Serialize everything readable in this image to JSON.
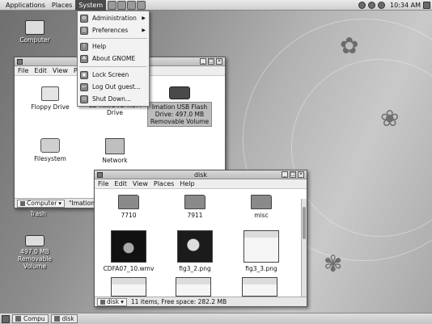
{
  "top_panel": {
    "menus": [
      "Applications",
      "Places",
      "System"
    ],
    "clock": "10:34 AM"
  },
  "system_menu": {
    "items": [
      {
        "label": "Administration",
        "icon": "admin-icon",
        "submenu": true
      },
      {
        "label": "Preferences",
        "icon": "preferences-icon",
        "submenu": true
      },
      {
        "label": "Help",
        "icon": "help-icon"
      },
      {
        "label": "About GNOME",
        "icon": "gnome-icon"
      },
      {
        "label": "Lock Screen",
        "icon": "lock-icon"
      },
      {
        "label": "Log Out guest...",
        "icon": "logout-icon"
      },
      {
        "label": "Shut Down...",
        "icon": "shutdown-icon"
      }
    ]
  },
  "desktop": {
    "icons": [
      {
        "label": "Computer"
      },
      {
        "label": "Trash"
      },
      {
        "label": "497.0 MB Removable Volume"
      }
    ]
  },
  "computer_window": {
    "menu": [
      "File",
      "Edit",
      "View",
      "Pl"
    ],
    "items": [
      {
        "label": "Floppy Drive"
      },
      {
        "label": "CD-RW/DVD-ROM Drive"
      },
      {
        "label": "Imation USB Flash Drive: 497.0 MB Removable Volume",
        "selected": true
      },
      {
        "label": "Filesystem"
      },
      {
        "label": "Network"
      }
    ],
    "status_location": "Computer",
    "status_text": "\"Imation U"
  },
  "disk_window": {
    "title": "disk",
    "menu": [
      "File",
      "Edit",
      "View",
      "Places",
      "Help"
    ],
    "items": [
      {
        "label": "7710",
        "kind": "folder"
      },
      {
        "label": "7911",
        "kind": "folder"
      },
      {
        "label": "misc",
        "kind": "folder"
      },
      {
        "label": "CDFA07_10.wmv",
        "kind": "video"
      },
      {
        "label": "fig3_2.png",
        "kind": "dark"
      },
      {
        "label": "fig3_3.png",
        "kind": "shot"
      }
    ],
    "status_location": "disk",
    "status_text": "11 items, Free space: 282.2 MB"
  },
  "bottom_panel": {
    "tasks": [
      "Compu",
      "disk"
    ]
  }
}
